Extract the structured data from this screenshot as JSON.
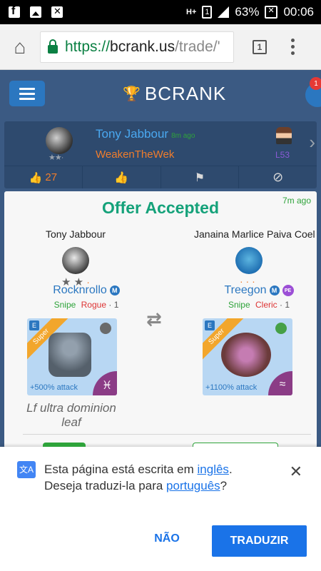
{
  "status_bar": {
    "signal_label": "H+",
    "sim": "1",
    "battery_percent": "63%",
    "time": "00:06"
  },
  "browser": {
    "url_scheme": "https://",
    "url_host": "bcrank.us",
    "url_path": "/trade/'",
    "tab_count": "1"
  },
  "site": {
    "logo_text": "BCRANK",
    "notification_count": "1"
  },
  "trade": {
    "author": "Tony Jabbour",
    "time_ago": "8m ago",
    "offer_text": "WeakenTheWek",
    "level": "L53",
    "likes": "27"
  },
  "offer": {
    "title": "Offer Accepted",
    "time_ago": "7m ago",
    "left_user": "Tony Jabbour",
    "right_user": "Janaina Marlice Paiva Coel",
    "left_monster": {
      "name": "Rocknrollo",
      "badges": [
        "M"
      ],
      "role": "Snipe",
      "class": "Rogue",
      "tier": "1",
      "super_label": "Super",
      "attack_bonus": "+500% attack"
    },
    "right_monster": {
      "name": "Treegon",
      "badges": [
        "M",
        "PE"
      ],
      "role": "Snipe",
      "class": "Cleric",
      "tier": "1",
      "super_label": "Super",
      "attack_bonus": "+1100% attack"
    },
    "note": "Lf ultra dominion leaf"
  },
  "translate_bar": {
    "line1_prefix": "Esta página está escrita em ",
    "source_language": "inglês",
    "line1_suffix": ".",
    "line2_prefix": "Deseja traduzi-la para ",
    "target_language": "português",
    "line2_suffix": "?",
    "decline_label": "NÃO",
    "accept_label": "TRADUZIR"
  }
}
